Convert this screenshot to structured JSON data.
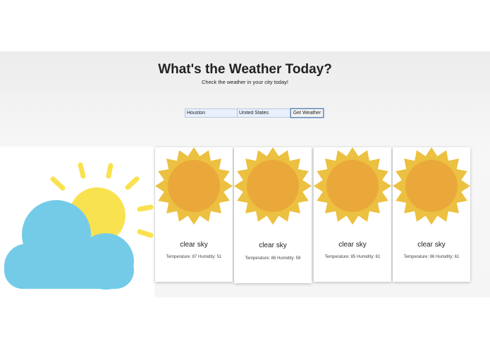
{
  "header": {
    "title": "What's the Weather Today?",
    "subtitle": "Check the weather in your city today!"
  },
  "search": {
    "city_value": "Houston",
    "country_value": "United States",
    "button_label": "Get Weather"
  },
  "hero": {
    "icon": "sun-behind-cloud-icon"
  },
  "forecast": [
    {
      "icon": "sun-icon",
      "condition": "clear sky",
      "stats": "Temperature: 87 Humidity: 51"
    },
    {
      "icon": "sun-icon",
      "condition": "clear sky",
      "stats": "Temperature: 86 Humidity: 59"
    },
    {
      "icon": "sun-icon",
      "condition": "clear sky",
      "stats": "Temperature: 85 Humidity: 61"
    },
    {
      "icon": "sun-icon",
      "condition": "clear sky",
      "stats": "Temperature: 86 Humidity: 61"
    }
  ],
  "colors": {
    "sun_outer": "#ecc040",
    "sun_inner": "#eba83a",
    "hero_sun": "#f9e24f",
    "hero_rays": "#f9e24f",
    "cloud": "#74cbe8"
  }
}
